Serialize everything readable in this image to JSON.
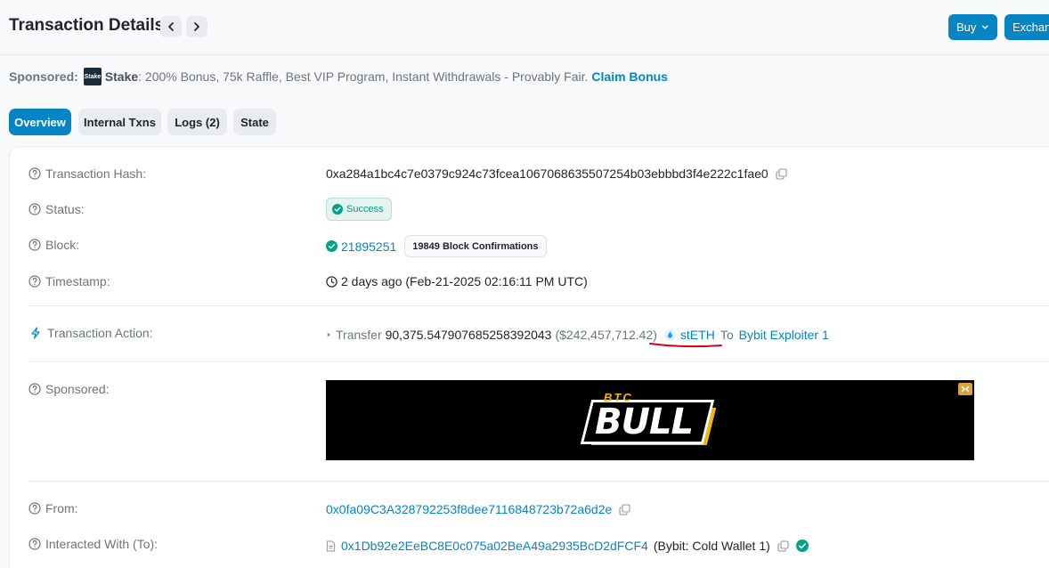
{
  "header": {
    "title": "Transaction Details",
    "buy_label": "Buy",
    "exchange_label": "Exchan",
    "prev_icon": "chevron-left-icon",
    "next_icon": "chevron-right-icon"
  },
  "sponsor": {
    "label": "Sponsored:",
    "logo_text": "Stake",
    "brand": "Stake",
    "text": ": 200% Bonus, 75k Raffle, Best VIP Program, Instant Withdrawals - Provably Fair.",
    "claim": "Claim Bonus"
  },
  "tabs": [
    {
      "label": "Overview",
      "active": true
    },
    {
      "label": "Internal Txns",
      "active": false
    },
    {
      "label": "Logs (2)",
      "active": false
    },
    {
      "label": "State",
      "active": false
    }
  ],
  "details": {
    "hash": {
      "label": "Transaction Hash:",
      "value": "0xa284a1bc4c7e0379c924c73fcea1067068635507254b03ebbbd3f4e222c1fae0"
    },
    "status": {
      "label": "Status:",
      "value": "Success"
    },
    "block": {
      "label": "Block:",
      "value": "21895251",
      "confirmations": "19849 Block Confirmations"
    },
    "timestamp": {
      "label": "Timestamp:",
      "value": "2 days ago (Feb-21-2025 02:16:11 PM UTC)"
    },
    "action": {
      "label": "Transaction Action:",
      "verb": "Transfer",
      "amount": "90,375.547907685258392043",
      "usd": "($242,457,712.42)",
      "token": "stETH",
      "to_word": "To",
      "recipient": "Bybit Exploiter 1"
    },
    "sponsored": {
      "label": "Sponsored:"
    },
    "from": {
      "label": "From:",
      "value": "0x0fa09C3A328792253f8dee7116848723b72a6d2e"
    },
    "to": {
      "label": "Interacted With (To):",
      "value": "0x1Db92e2EeBC8E0c075a02BeA49a2935BcD2dFCF4",
      "name": "(Bybit: Cold Wallet 1)"
    }
  },
  "ad": {
    "top_text": "BTC",
    "main_text": "BULL"
  },
  "colors": {
    "accent": "#0784c3",
    "success": "#00a186",
    "annotation": "#d0021b"
  }
}
